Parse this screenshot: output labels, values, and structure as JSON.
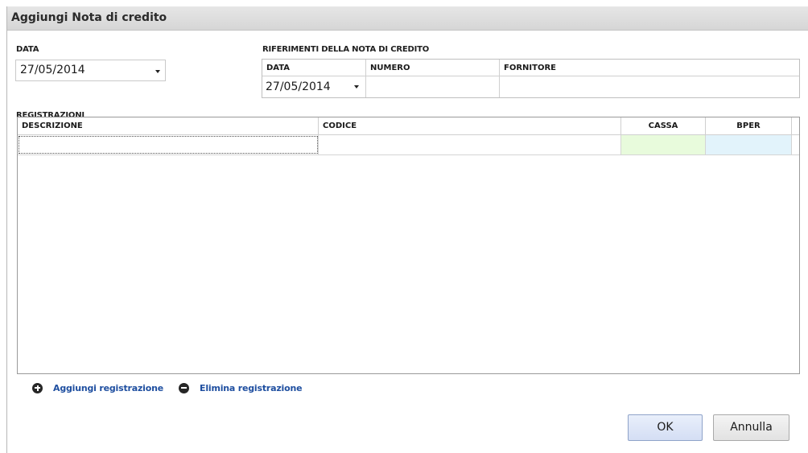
{
  "window": {
    "title": "Aggiungi Nota di credito"
  },
  "data_field": {
    "label": "DATA",
    "value": "27/05/2014"
  },
  "references": {
    "label": "RIFERIMENTI DELLA NOTA DI CREDITO",
    "columns": [
      "DATA",
      "NUMERO",
      "FORNITORE"
    ],
    "row": {
      "data": "27/05/2014",
      "numero": "",
      "fornitore": ""
    }
  },
  "registrations": {
    "label": "REGISTRAZIONI",
    "columns": [
      "DESCRIZIONE",
      "CODICE",
      "CASSA",
      "BPER"
    ],
    "rows": [
      {
        "descrizione": "",
        "codice": "",
        "cassa": "",
        "bper": ""
      }
    ],
    "column_colors": {
      "cassa": "#e8fbdc",
      "bper": "#e2f3fb"
    }
  },
  "actions": {
    "add": "Aggiungi registrazione",
    "remove": "Elimina registrazione",
    "add_icon": "plus-circle-icon",
    "remove_icon": "minus-circle-icon",
    "link_color": "#1f4fa0"
  },
  "buttons": {
    "ok": "OK",
    "cancel": "Annulla"
  }
}
